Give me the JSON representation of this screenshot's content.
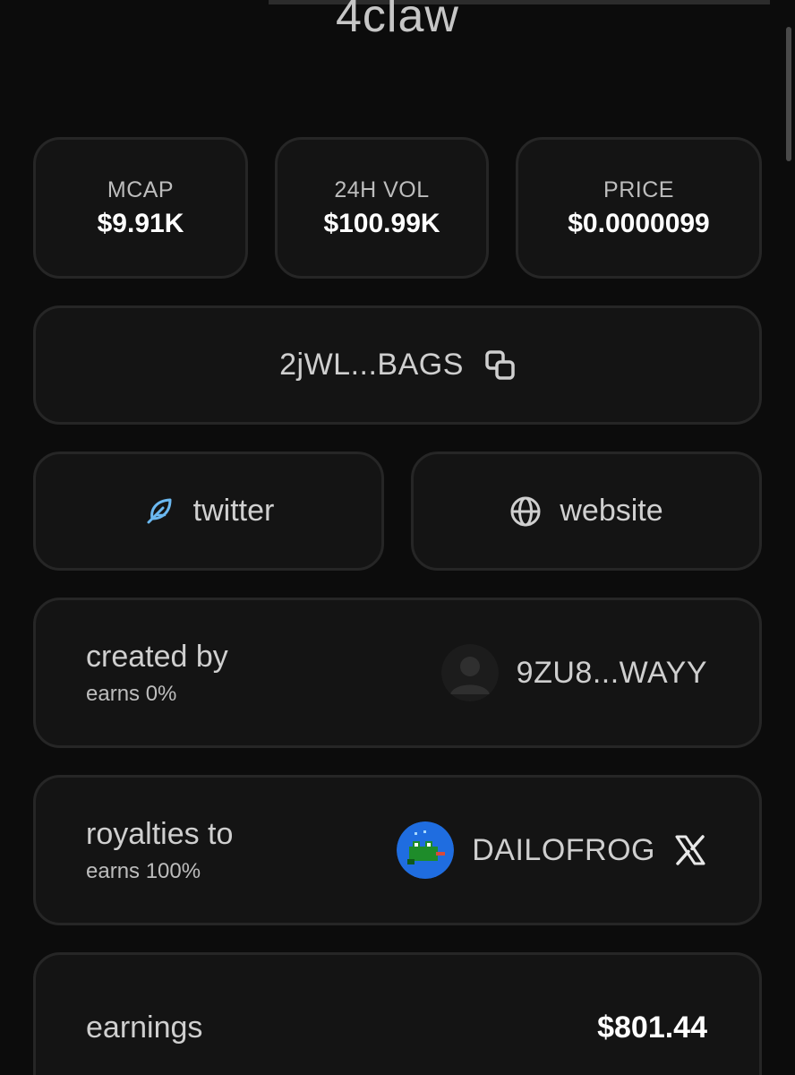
{
  "token": {
    "name": "4claw"
  },
  "stats": [
    {
      "label": "MCAP",
      "value": "$9.91K"
    },
    {
      "label": "24H VOL",
      "value": "$100.99K"
    },
    {
      "label": "PRICE",
      "value": "$0.0000099"
    }
  ],
  "contract": {
    "address": "2jWL...BAGS",
    "icon": "copy-icon"
  },
  "links": {
    "twitter": {
      "label": "twitter",
      "icon": "feather-icon",
      "icon_color": "#6bb8f0"
    },
    "website": {
      "label": "website",
      "icon": "globe-icon"
    }
  },
  "creator": {
    "label": "created by",
    "earns": "earns 0%",
    "user": "9ZU8...WAYY",
    "avatar": "default-avatar-icon"
  },
  "royalties": {
    "label": "royalties to",
    "earns": "earns 100%",
    "user": "DAILOFROG",
    "avatar": "frog-avatar-icon",
    "social_icon": "x-logo-icon",
    "avatar_bg": "#1f6de0"
  },
  "earnings": {
    "label": "earnings",
    "value": "$801.44"
  }
}
